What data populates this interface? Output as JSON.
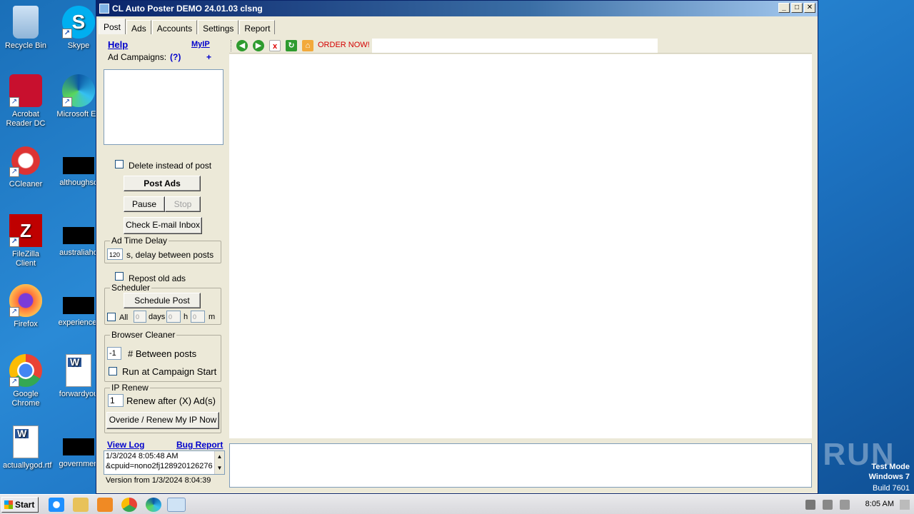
{
  "desktop": {
    "icons": [
      {
        "label": "Recycle Bin"
      },
      {
        "label": "Skype"
      },
      {
        "label": "Acrobat Reader DC"
      },
      {
        "label": "Microsoft Ed"
      },
      {
        "label": "CCleaner"
      },
      {
        "label": "althoughsc"
      },
      {
        "label": "FileZilla Client"
      },
      {
        "label": "australiaho"
      },
      {
        "label": "Firefox"
      },
      {
        "label": "experiencef"
      },
      {
        "label": "Google Chrome"
      },
      {
        "label": "forwardyou"
      },
      {
        "label": "actuallygod.rtf"
      },
      {
        "label": "governmen"
      }
    ],
    "watermark": {
      "line1": "Test Mode",
      "line2": "Windows 7",
      "line3": "Build 7601",
      "brand": "ANY RUN"
    }
  },
  "window": {
    "title": "CL Auto Poster  DEMO 24.01.03  clsng",
    "tabs": [
      "Post",
      "Ads",
      "Accounts",
      "Settings",
      "Report"
    ],
    "left": {
      "help_link": "Help",
      "myip_link": "MyIP",
      "campaigns_label": "Ad Campaigns:",
      "campaigns_help": "(?)",
      "campaigns_add": "+",
      "delete_label": "Delete instead of post",
      "post_ads": "Post Ads",
      "pause": "Pause",
      "stop": "Stop",
      "check_email": "Check E-mail Inbox",
      "time_delay_group": "Ad Time Delay",
      "delay_value": "120",
      "delay_label": "s, delay between posts",
      "repost_label": "Repost old ads",
      "scheduler_group": "Scheduler",
      "schedule_post": "Schedule Post",
      "all_label": "All",
      "days_value": "0",
      "days_label": "days",
      "hours_value": "0",
      "hours_label": "h",
      "min_value": "0",
      "min_label": "m",
      "browser_cleaner_group": "Browser Cleaner",
      "between_value": "-1",
      "between_label": "# Between posts",
      "run_at_start": "Run at Campaign Start",
      "ip_renew_group": "IP Renew",
      "renew_value": "1",
      "renew_label": "Renew after (X) Ad(s)",
      "override_btn": "Overide / Renew My IP Now",
      "view_log": "View Log",
      "bug_report": "Bug Report",
      "log_line1": "1/3/2024 8:05:48 AM",
      "log_line2": "&cpuid=nono2fj128920126276",
      "version": "Version from 1/3/2024 8:04:39"
    },
    "toolbar": {
      "order_now": "ORDER NOW!"
    }
  },
  "taskbar": {
    "start": "Start",
    "time": "8:05 AM"
  }
}
